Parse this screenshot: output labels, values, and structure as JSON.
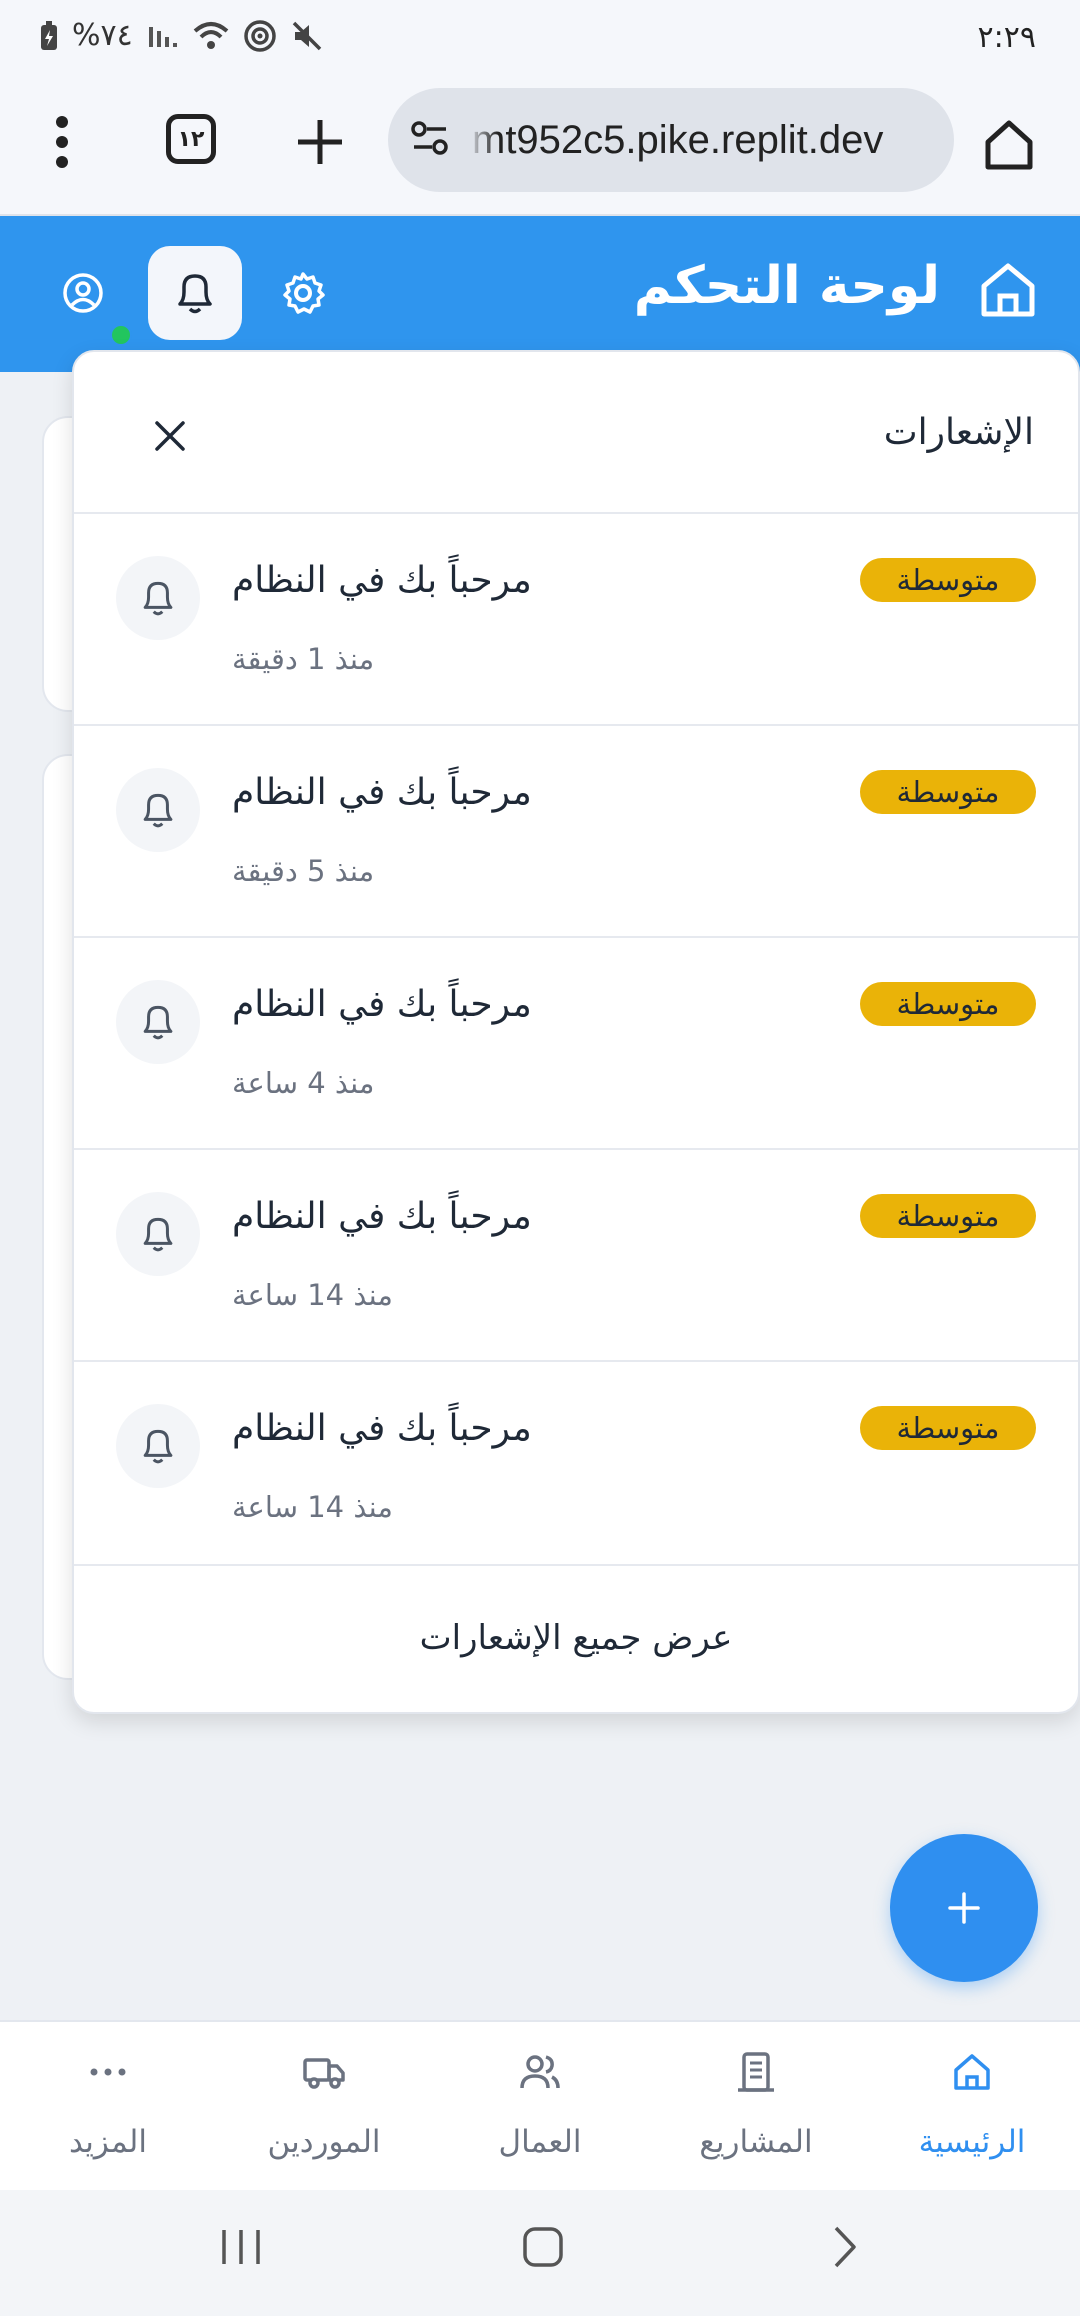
{
  "status_bar": {
    "time": "٢:٢٩",
    "battery": "%٧٤"
  },
  "browser": {
    "url": "mt952c5.pike.replit.dev",
    "tab_count": "١٢"
  },
  "header": {
    "title": "لوحة التحكم"
  },
  "notifications_panel": {
    "title": "الإشعارات",
    "items": [
      {
        "title": "مرحباً بك في النظام",
        "time": "منذ 1 دقيقة",
        "priority": "متوسطة"
      },
      {
        "title": "مرحباً بك في النظام",
        "time": "منذ 5 دقيقة",
        "priority": "متوسطة"
      },
      {
        "title": "مرحباً بك في النظام",
        "time": "منذ 4 ساعة",
        "priority": "متوسطة"
      },
      {
        "title": "مرحباً بك في النظام",
        "time": "منذ 14 ساعة",
        "priority": "متوسطة"
      },
      {
        "title": "مرحباً بك في النظام",
        "time": "منذ 14 ساعة",
        "priority": "متوسطة"
      }
    ],
    "view_all": "عرض جميع الإشعارات"
  },
  "fab": {
    "icon": "plus-icon"
  },
  "bottom_nav": {
    "items": [
      {
        "label": "الرئيسية",
        "icon": "home-icon",
        "active": true
      },
      {
        "label": "المشاريع",
        "icon": "projects-icon",
        "active": false
      },
      {
        "label": "العمال",
        "icon": "users-icon",
        "active": false
      },
      {
        "label": "الموردين",
        "icon": "truck-icon",
        "active": false
      },
      {
        "label": "المزيد",
        "icon": "more-icon",
        "active": false
      }
    ]
  },
  "colors": {
    "primary": "#2f95ee",
    "badge": "#eab308",
    "online": "#22c55e"
  }
}
